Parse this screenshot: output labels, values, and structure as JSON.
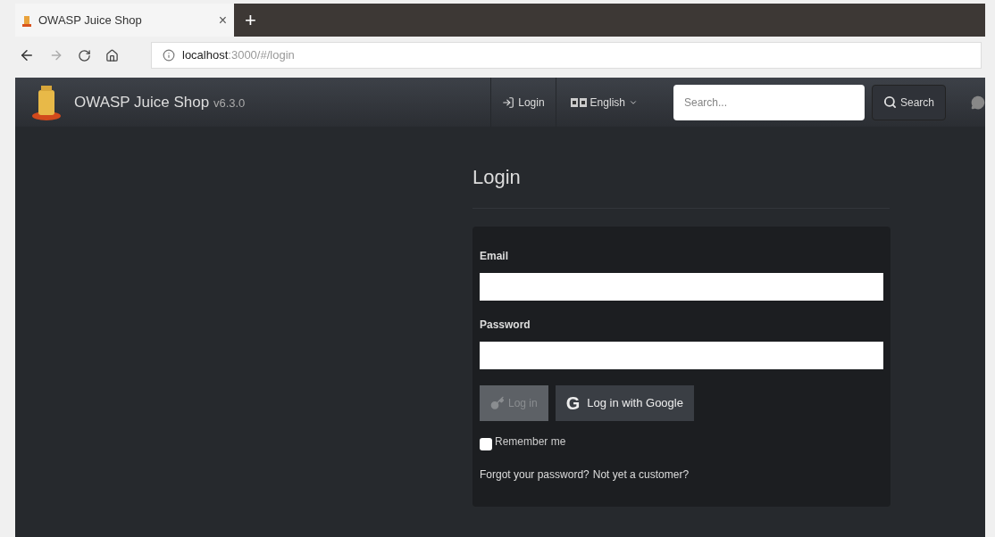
{
  "browser": {
    "tab": {
      "title": "OWASP Juice Shop",
      "close": "×"
    },
    "new_tab": "+",
    "address": {
      "host": "localhost",
      "path": ":3000/#/login"
    }
  },
  "navbar": {
    "brand": "OWASP Juice Shop",
    "version": "v6.3.0",
    "login": "Login",
    "language": "English",
    "search": {
      "placeholder": "Search..."
    },
    "search_button": "Search"
  },
  "page": {
    "title": "Login",
    "email_label": "Email",
    "password_label": "Password",
    "login_button": {
      "label": "Log in",
      "disabled": true
    },
    "google_icon": "G",
    "google_button": "Log in with Google",
    "remember": {
      "label": "Remember me",
      "checked": false
    },
    "links": [
      "Forgot your password?",
      "Not yet a customer?"
    ]
  }
}
